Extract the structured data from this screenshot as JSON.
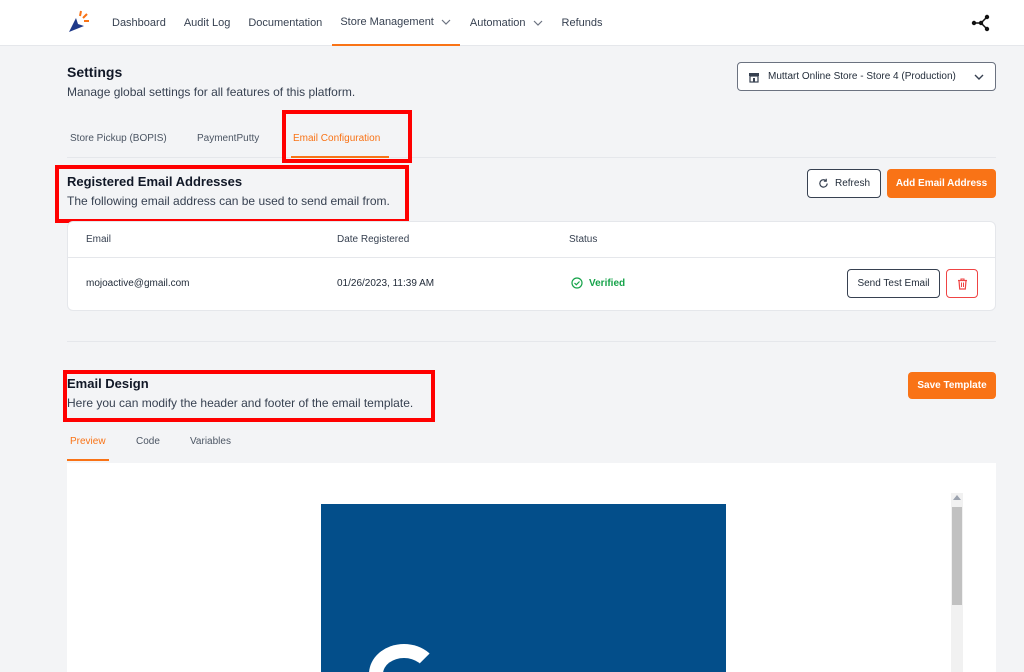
{
  "nav": {
    "items": [
      {
        "label": "Dashboard"
      },
      {
        "label": "Audit Log"
      },
      {
        "label": "Documentation"
      },
      {
        "label": "Store Management"
      },
      {
        "label": "Automation"
      },
      {
        "label": "Refunds"
      }
    ]
  },
  "header": {
    "title": "Settings",
    "subtitle": "Manage global settings for all features of this platform.",
    "store_select": "Muttart Online Store - Store 4 (Production)"
  },
  "tabs": [
    {
      "label": "Store Pickup (BOPIS)"
    },
    {
      "label": "PaymentPutty"
    },
    {
      "label": "Email Configuration"
    }
  ],
  "registered": {
    "title": "Registered Email Addresses",
    "subtitle": "The following email address can be used to send email from.",
    "refresh_label": "Refresh",
    "add_label": "Add Email Address",
    "columns": [
      "Email",
      "Date Registered",
      "Status"
    ],
    "rows": [
      {
        "email": "mojoactive@gmail.com",
        "date": "01/26/2023, 11:39 AM",
        "status": "Verified",
        "test_label": "Send Test Email"
      }
    ]
  },
  "design": {
    "title": "Email Design",
    "subtitle": "Here you can modify the header and footer of the email template.",
    "save_label": "Save Template",
    "tabs": [
      {
        "label": "Preview"
      },
      {
        "label": "Code"
      },
      {
        "label": "Variables"
      }
    ]
  },
  "colors": {
    "accent": "#f97316",
    "verified": "#16a34a",
    "email_header_bg": "#034e8a",
    "annotation": "#ff0000"
  }
}
